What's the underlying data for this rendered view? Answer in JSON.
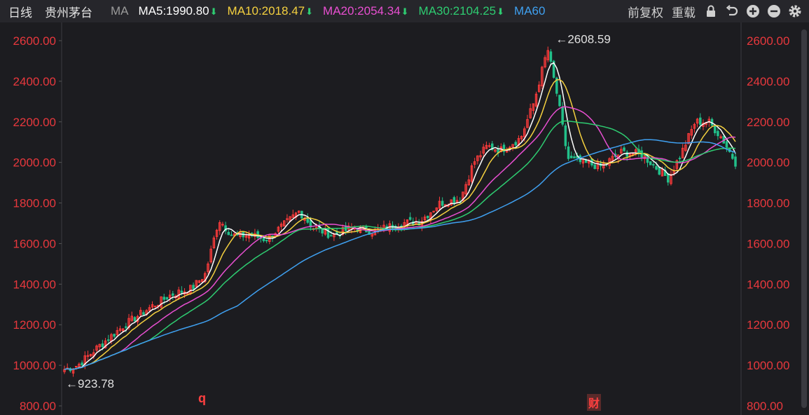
{
  "toolbar": {
    "period": "日线",
    "stock_name": "贵州茅台",
    "ma_label": "MA",
    "ma": [
      {
        "label": "MA5:1990.80",
        "color": "#ffffff",
        "arrow": "⬇"
      },
      {
        "label": "MA10:2018.47",
        "color": "#f4d03f",
        "arrow": "⬇"
      },
      {
        "label": "MA20:2054.34",
        "color": "#e84fd1",
        "arrow": "⬇"
      },
      {
        "label": "MA30:2104.25",
        "color": "#2ecc71",
        "arrow": "⬇"
      },
      {
        "label": "MA60",
        "color": "#3fa0f0",
        "arrow": ""
      }
    ],
    "adjust": "前复权",
    "reload": "重载",
    "icons": [
      "lock-icon",
      "undo-icon",
      "zoom-in-icon",
      "zoom-out-icon",
      "settings-icon"
    ]
  },
  "markers": {
    "left": "q",
    "mid": "财"
  },
  "chart_data": {
    "type": "candlestick",
    "ylim": [
      800,
      2600
    ],
    "yticks": [
      "2600.00",
      "2400.00",
      "2200.00",
      "2000.00",
      "1800.00",
      "1600.00",
      "1400.00",
      "1200.00",
      "1000.00",
      "800.00"
    ],
    "annotations": [
      {
        "text": "←2608.59",
        "value": 2608.59,
        "index": 0.73
      },
      {
        "text": "←923.78",
        "value": 923.78,
        "index": 0.0
      }
    ],
    "price_path": [
      [
        0.0,
        980
      ],
      [
        0.02,
        1000
      ],
      [
        0.05,
        1090
      ],
      [
        0.09,
        1200
      ],
      [
        0.13,
        1290
      ],
      [
        0.16,
        1350
      ],
      [
        0.19,
        1380
      ],
      [
        0.21,
        1450
      ],
      [
        0.23,
        1720
      ],
      [
        0.25,
        1640
      ],
      [
        0.28,
        1640
      ],
      [
        0.3,
        1620
      ],
      [
        0.33,
        1700
      ],
      [
        0.35,
        1760
      ],
      [
        0.37,
        1680
      ],
      [
        0.4,
        1640
      ],
      [
        0.43,
        1680
      ],
      [
        0.46,
        1660
      ],
      [
        0.5,
        1700
      ],
      [
        0.53,
        1710
      ],
      [
        0.56,
        1800
      ],
      [
        0.59,
        1820
      ],
      [
        0.61,
        2000
      ],
      [
        0.63,
        2080
      ],
      [
        0.65,
        2060
      ],
      [
        0.68,
        2120
      ],
      [
        0.7,
        2300
      ],
      [
        0.72,
        2560
      ],
      [
        0.735,
        2320
      ],
      [
        0.75,
        2020
      ],
      [
        0.77,
        2000
      ],
      [
        0.8,
        1980
      ],
      [
        0.83,
        2050
      ],
      [
        0.86,
        2040
      ],
      [
        0.88,
        1980
      ],
      [
        0.9,
        1920
      ],
      [
        0.92,
        2050
      ],
      [
        0.94,
        2200
      ],
      [
        0.96,
        2200
      ],
      [
        0.98,
        2120
      ],
      [
        1.0,
        2000
      ]
    ],
    "ma5_last": 1990.8,
    "ma10_last": 2018.47,
    "ma20_last": 2054.34,
    "ma30_last": 2104.25,
    "ma60_last": 2070
  }
}
